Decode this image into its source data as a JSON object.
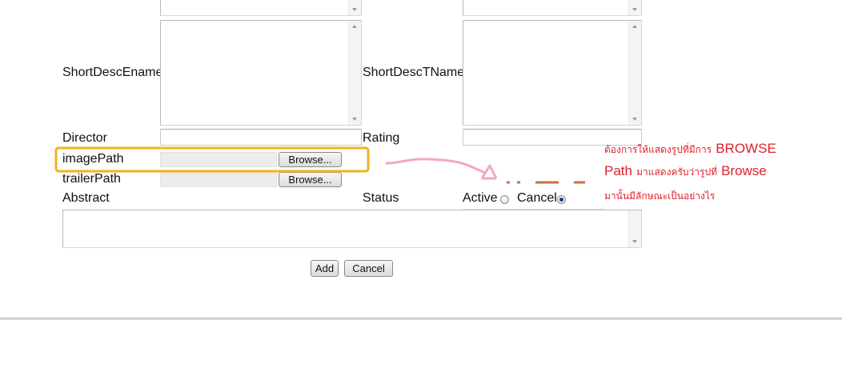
{
  "form": {
    "short_desc_e_label": "ShortDescEname",
    "short_desc_t_label": "ShortDescTName",
    "director_label": "Director",
    "rating_label": "Rating",
    "image_path_label": "imagePath",
    "trailer_path_label": "trailerPath",
    "abstract_label": "Abstract",
    "status_label": "Status",
    "status_options": [
      {
        "label": "Active",
        "checked": false
      },
      {
        "label": "Cancel",
        "checked": true
      }
    ],
    "browse_label": "Browse...",
    "add_label": "Add",
    "cancel_label": "Cancel"
  },
  "annotation": {
    "line1_thai": "ต้องการให้แสดงรูปที่มีการ",
    "line1_en": "BROWSE",
    "line2_en_a": "Path",
    "line2_thai": "มาแสดงครับว่ารูปที่",
    "line2_en_b": "Browse",
    "line3_thai": "มานั้นมีลักษณะเป็นอย่างไร",
    "highlight_color": "#f2b31a",
    "arrow_color": "#f3a6c6",
    "dash_color": "#c8723b",
    "text_color": "#e0202b"
  }
}
